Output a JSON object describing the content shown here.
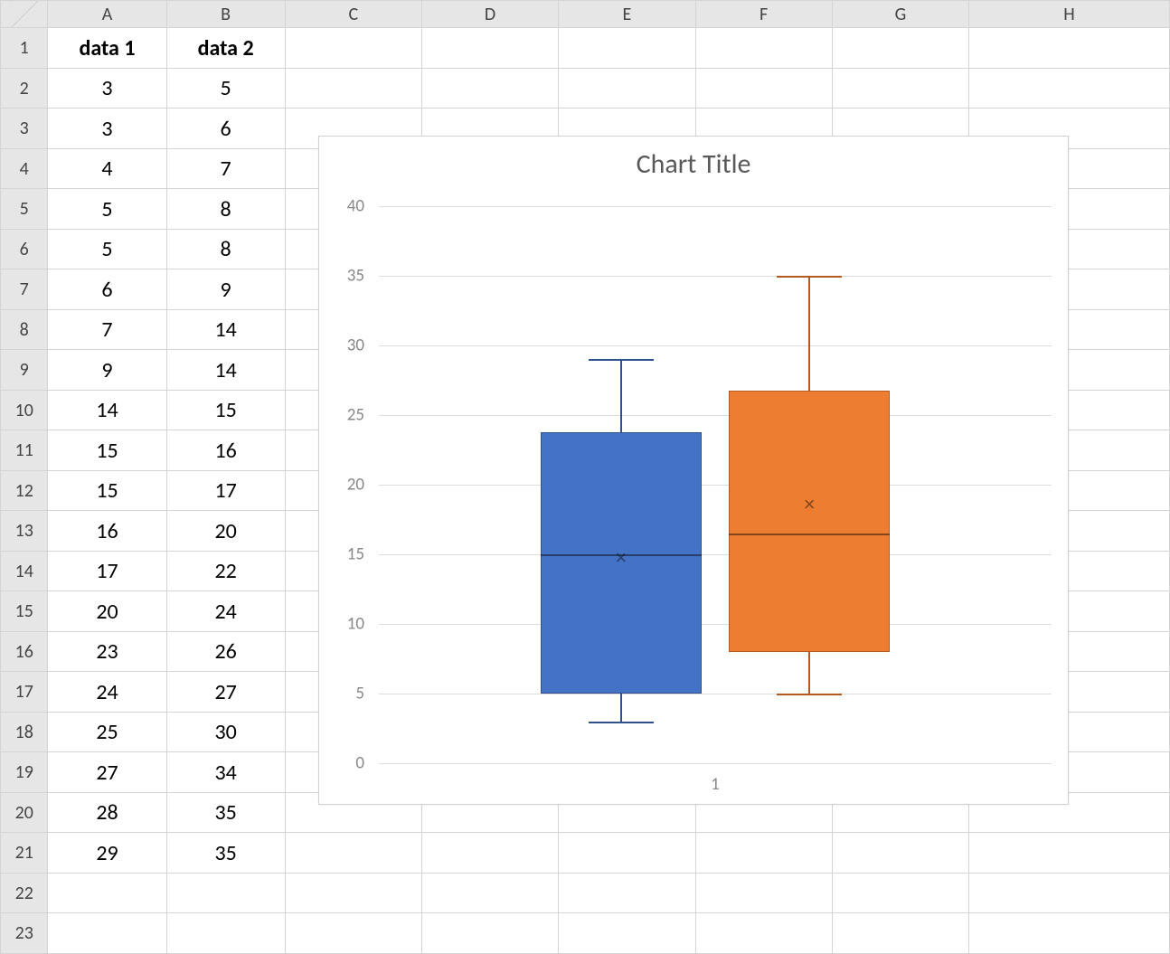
{
  "columns": [
    "A",
    "B",
    "C",
    "D",
    "E",
    "F",
    "G",
    "H"
  ],
  "row_count": 23,
  "table": {
    "headers": {
      "A": "data 1",
      "B": "data 2"
    },
    "rows": [
      {
        "A": "3",
        "B": "5"
      },
      {
        "A": "3",
        "B": "6"
      },
      {
        "A": "4",
        "B": "7"
      },
      {
        "A": "5",
        "B": "8"
      },
      {
        "A": "5",
        "B": "8"
      },
      {
        "A": "6",
        "B": "9"
      },
      {
        "A": "7",
        "B": "14"
      },
      {
        "A": "9",
        "B": "14"
      },
      {
        "A": "14",
        "B": "15"
      },
      {
        "A": "15",
        "B": "16"
      },
      {
        "A": "15",
        "B": "17"
      },
      {
        "A": "16",
        "B": "20"
      },
      {
        "A": "17",
        "B": "22"
      },
      {
        "A": "20",
        "B": "24"
      },
      {
        "A": "23",
        "B": "26"
      },
      {
        "A": "24",
        "B": "27"
      },
      {
        "A": "25",
        "B": "30"
      },
      {
        "A": "27",
        "B": "34"
      },
      {
        "A": "28",
        "B": "35"
      },
      {
        "A": "29",
        "B": "35"
      }
    ]
  },
  "chart_data": {
    "type": "boxplot",
    "title": "Chart Title",
    "xlabel": "1",
    "ylabel": "",
    "ylim": [
      0,
      40
    ],
    "yticks": [
      0,
      5,
      10,
      15,
      20,
      25,
      30,
      35,
      40
    ],
    "categories": [
      "1"
    ],
    "series": [
      {
        "name": "data 1",
        "color": "#4472c4",
        "min": 3,
        "q1": 5,
        "median": 15,
        "mean": 14.75,
        "q3": 23.75,
        "max": 29
      },
      {
        "name": "data 2",
        "color": "#ed7d31",
        "min": 5,
        "q1": 8,
        "median": 16.5,
        "mean": 18.55,
        "q3": 26.75,
        "max": 35
      }
    ]
  }
}
